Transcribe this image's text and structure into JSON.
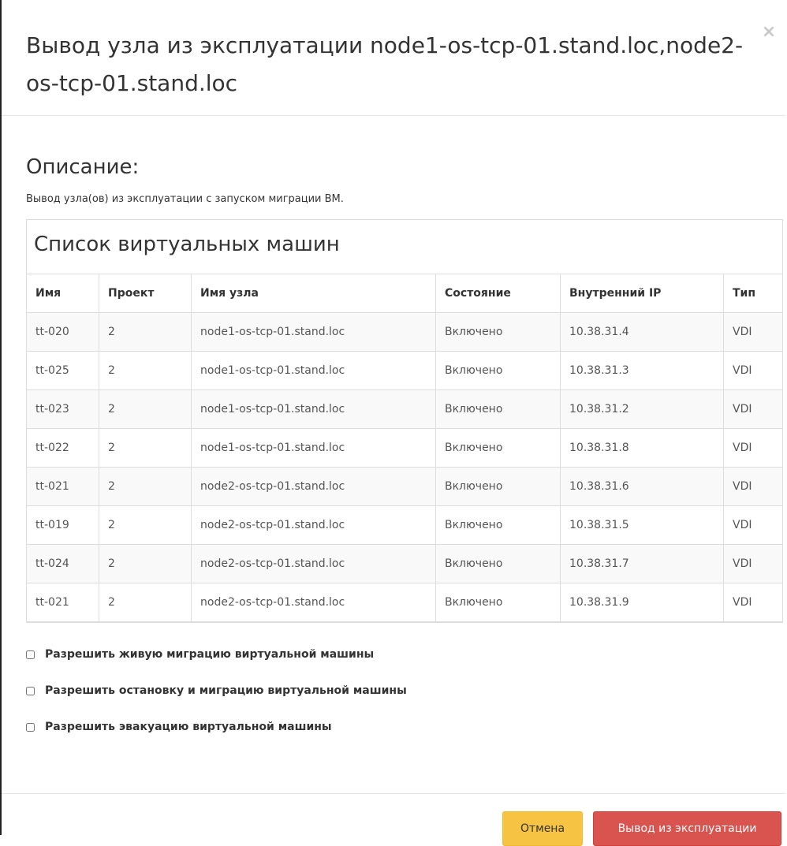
{
  "modal": {
    "title": "Вывод узла из эксплуатации node1-os-tcp-01.stand.loc,node2-os-tcp-01.stand.loc",
    "close_label": "×"
  },
  "description": {
    "heading": "Описание:",
    "text": "Вывод узла(ов) из эксплуатации с запуском миграции ВМ."
  },
  "vm_list": {
    "title": "Список виртуальных машин",
    "columns": [
      "Имя",
      "Проект",
      "Имя узла",
      "Состояние",
      "Внутренний IP",
      "Тип"
    ],
    "rows": [
      [
        "tt-020",
        "2",
        "node1-os-tcp-01.stand.loc",
        "Включено",
        "10.38.31.4",
        "VDI"
      ],
      [
        "tt-025",
        "2",
        "node1-os-tcp-01.stand.loc",
        "Включено",
        "10.38.31.3",
        "VDI"
      ],
      [
        "tt-023",
        "2",
        "node1-os-tcp-01.stand.loc",
        "Включено",
        "10.38.31.2",
        "VDI"
      ],
      [
        "tt-022",
        "2",
        "node1-os-tcp-01.stand.loc",
        "Включено",
        "10.38.31.8",
        "VDI"
      ],
      [
        "tt-021",
        "2",
        "node2-os-tcp-01.stand.loc",
        "Включено",
        "10.38.31.6",
        "VDI"
      ],
      [
        "tt-019",
        "2",
        "node2-os-tcp-01.stand.loc",
        "Включено",
        "10.38.31.5",
        "VDI"
      ],
      [
        "tt-024",
        "2",
        "node2-os-tcp-01.stand.loc",
        "Включено",
        "10.38.31.7",
        "VDI"
      ],
      [
        "tt-021",
        "2",
        "node2-os-tcp-01.stand.loc",
        "Включено",
        "10.38.31.9",
        "VDI"
      ]
    ]
  },
  "options": [
    {
      "label": "Разрешить живую миграцию виртуальной машины",
      "checked": false
    },
    {
      "label": "Разрешить остановку и миграцию виртуальной машины",
      "checked": false
    },
    {
      "label": "Разрешить эвакуацию виртуальной машины",
      "checked": false
    }
  ],
  "footer": {
    "cancel_label": "Отмена",
    "submit_label": "Вывод из эксплуатации"
  },
  "colors": {
    "cancel_bg": "#f6c342",
    "submit_bg": "#d9534f"
  }
}
